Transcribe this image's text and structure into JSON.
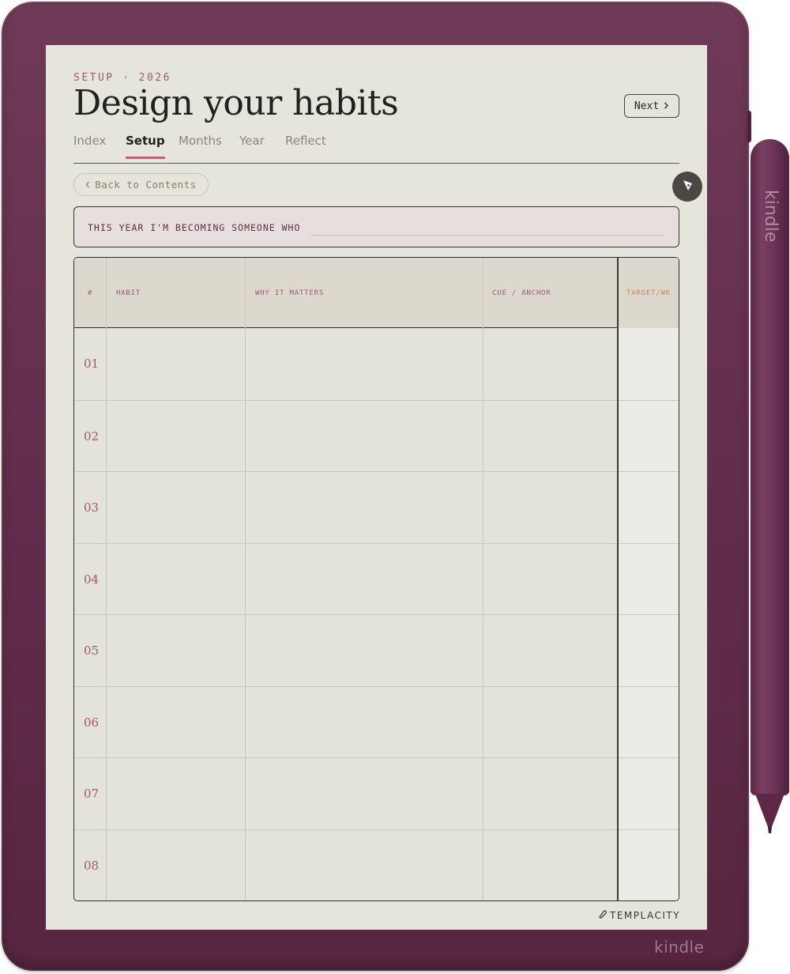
{
  "device": {
    "brand": "kindle",
    "stylus_brand": "kindle"
  },
  "page": {
    "eyebrow": "SETUP · 2026",
    "title": "Design your habits",
    "next_label": "Next",
    "next_icon": "chevron-right-icon"
  },
  "tabs": [
    {
      "label": "Index",
      "active": false
    },
    {
      "label": "Setup",
      "active": true
    },
    {
      "label": "Months",
      "active": false
    },
    {
      "label": "Year",
      "active": false
    },
    {
      "label": "Reflect",
      "active": false
    }
  ],
  "back": {
    "label": "Back to Contents",
    "icon": "chevron-left-icon"
  },
  "pen_tool": {
    "icon": "pen-nib-icon"
  },
  "intention": {
    "label": "THIS YEAR I'M BECOMING SOMEONE WHO",
    "value": ""
  },
  "table": {
    "headers": [
      "#",
      "HABIT",
      "WHY IT MATTERS",
      "CUE / ANCHOR",
      "TARGET/WK"
    ],
    "rows": [
      {
        "num": "01",
        "habit": "",
        "why": "",
        "cue": "",
        "target": ""
      },
      {
        "num": "02",
        "habit": "",
        "why": "",
        "cue": "",
        "target": ""
      },
      {
        "num": "03",
        "habit": "",
        "why": "",
        "cue": "",
        "target": ""
      },
      {
        "num": "04",
        "habit": "",
        "why": "",
        "cue": "",
        "target": ""
      },
      {
        "num": "05",
        "habit": "",
        "why": "",
        "cue": "",
        "target": ""
      },
      {
        "num": "06",
        "habit": "",
        "why": "",
        "cue": "",
        "target": ""
      },
      {
        "num": "07",
        "habit": "",
        "why": "",
        "cue": "",
        "target": ""
      },
      {
        "num": "08",
        "habit": "",
        "why": "",
        "cue": "",
        "target": ""
      }
    ]
  },
  "footer": {
    "brand": "TEMPLACITY",
    "icon": "templacity-logo-icon"
  },
  "colors": {
    "device": "#66304f",
    "screen": "#e6e5dc",
    "accent": "#9a5a70",
    "tab_underline": "#c4607c",
    "target_header": "#c8865a"
  }
}
